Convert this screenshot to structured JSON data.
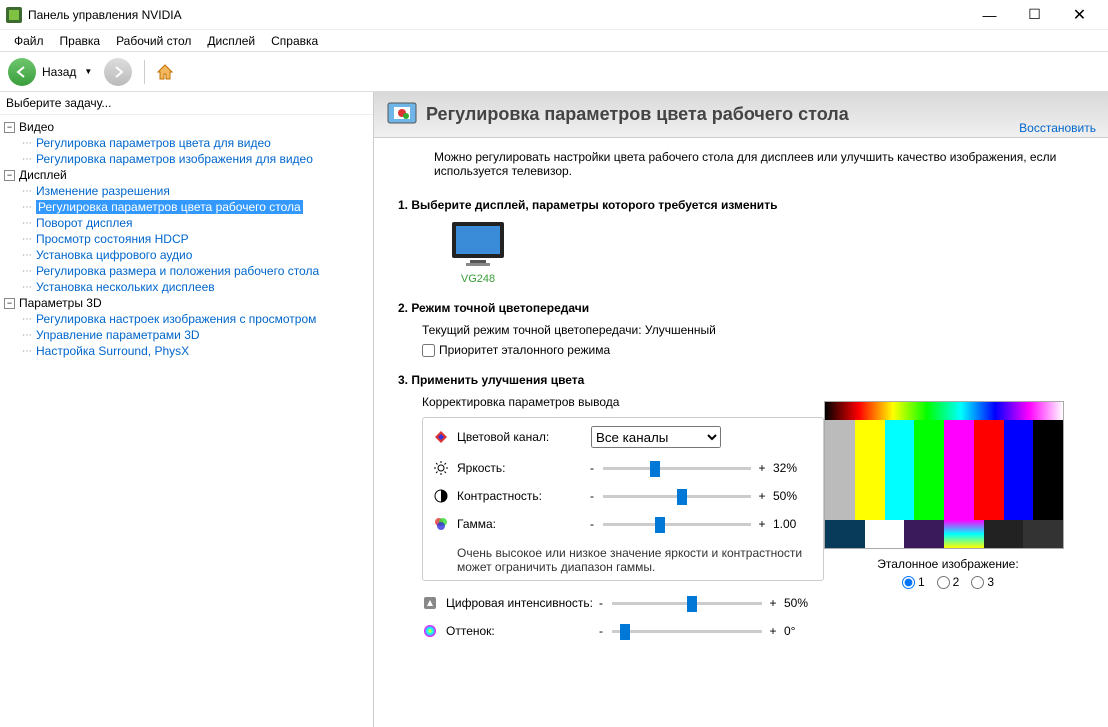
{
  "app": {
    "title": "Панель управления NVIDIA"
  },
  "window_controls": {
    "minimize": "—",
    "maximize": "☐",
    "close": "✕"
  },
  "menubar": [
    "Файл",
    "Правка",
    "Рабочий стол",
    "Дисплей",
    "Справка"
  ],
  "toolbar": {
    "back_label": "Назад"
  },
  "sidebar": {
    "header": "Выберите задачу...",
    "groups": [
      {
        "label": "Видео",
        "children": [
          "Регулировка параметров цвета для видео",
          "Регулировка параметров изображения для видео"
        ]
      },
      {
        "label": "Дисплей",
        "children": [
          "Изменение разрешения",
          "Регулировка параметров цвета рабочего стола",
          "Поворот дисплея",
          "Просмотр состояния HDCP",
          "Установка цифрового аудио",
          "Регулировка размера и положения рабочего стола",
          "Установка нескольких дисплеев"
        ],
        "selected_index": 1
      },
      {
        "label": "Параметры 3D",
        "children": [
          "Регулировка настроек изображения с просмотром",
          "Управление параметрами 3D",
          "Настройка Surround, PhysX"
        ]
      }
    ]
  },
  "banner": {
    "title": "Регулировка параметров цвета рабочего стола",
    "restore": "Восстановить"
  },
  "description": "Можно регулировать настройки цвета рабочего стола для дисплеев или улучшить качество изображения, если используется телевизор.",
  "sections": {
    "s1": {
      "title": "1. Выберите дисплей, параметры которого требуется изменить",
      "display_name": "VG248"
    },
    "s2": {
      "title": "2. Режим точной цветопередачи",
      "current_mode_label": "Текущий режим точной цветопередачи: Улучшенный",
      "checkbox_label": "Приоритет эталонного режима"
    },
    "s3": {
      "title": "3. Применить улучшения цвета",
      "subhead": "Корректировка параметров вывода",
      "channel_label": "Цветовой канал:",
      "channel_value": "Все каналы",
      "sliders": {
        "brightness": {
          "label": "Яркость:",
          "value": "32%",
          "pos": 32
        },
        "contrast": {
          "label": "Контрастность:",
          "value": "50%",
          "pos": 50
        },
        "gamma": {
          "label": "Гамма:",
          "value": "1.00",
          "pos": 35
        }
      },
      "note": "Очень высокое или низкое значение яркости и контрастности может ограничить диапазон гаммы.",
      "extra": {
        "digital_vibrance": {
          "label": "Цифровая интенсивность:",
          "value": "50%",
          "pos": 50
        },
        "hue": {
          "label": "Оттенок:",
          "value": "0°",
          "pos": 5
        }
      }
    }
  },
  "preview": {
    "label": "Эталонное изображение:",
    "options": [
      "1",
      "2",
      "3"
    ],
    "selected": "1"
  }
}
